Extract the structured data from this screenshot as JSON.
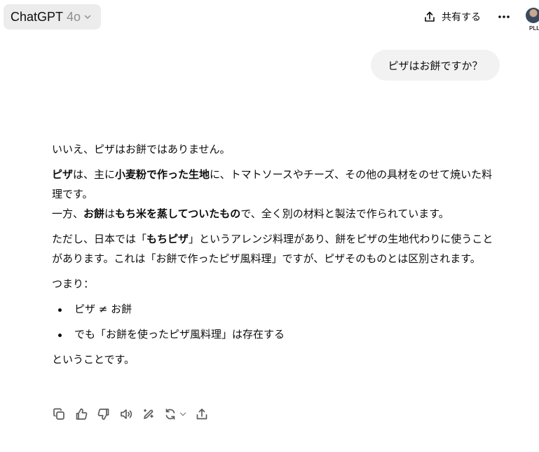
{
  "header": {
    "model_name": "ChatGPT",
    "model_version": "4o",
    "share_label": "共有する",
    "avatar_text": "PLL"
  },
  "user_message": "ピザはお餅ですか？",
  "answer": {
    "p1": "いいえ、ピザはお餅ではありません。",
    "p2_b1": "ピザ",
    "p2_t1": "は、主に",
    "p2_b2": "小麦粉で作った生地",
    "p2_t2": "に、トマトソースやチーズ、その他の具材をのせて焼いた料理です。",
    "p3_t1": "一方、",
    "p3_b1": "お餅",
    "p3_t2": "は",
    "p3_b2": "もち米を蒸してついたもの",
    "p3_t3": "で、全く別の材料と製法で作られています。",
    "p4_t1": "ただし、日本では「",
    "p4_b1": "もちピザ",
    "p4_t2": "」というアレンジ料理があり、餅をピザの生地代わりに使うことがあります。これは「お餅で作ったピザ風料理」ですが、ピザそのものとは区別されます。",
    "p5": "つまり：",
    "bullets": [
      "ピザ ≠ お餅",
      "でも「お餅を使ったピザ風料理」は存在する"
    ],
    "p6": "ということです。"
  },
  "actions": [
    "copy-icon",
    "thumbs-up-icon",
    "thumbs-down-icon",
    "read-aloud-icon",
    "edit-canvas-icon",
    "regenerate-icon",
    "share-icon"
  ]
}
